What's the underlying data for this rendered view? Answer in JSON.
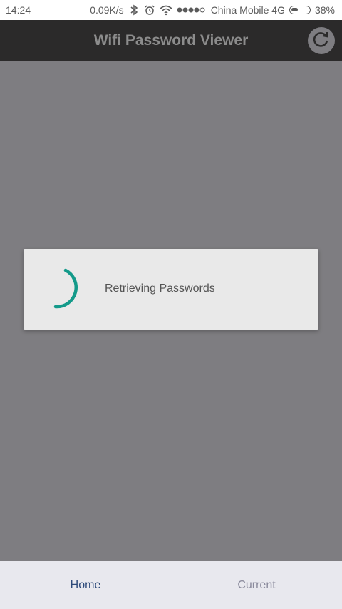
{
  "status_bar": {
    "time": "14:24",
    "speed": "0.09K/s",
    "carrier": "China Mobile 4G",
    "battery": "38%",
    "battery_level": 0.38,
    "icons": [
      "bluetooth-icon",
      "alarm-icon",
      "wifi-icon",
      "signal-dots-icon",
      "battery-icon"
    ]
  },
  "app_bar": {
    "title": "Wifi Password Viewer",
    "refresh_icon": "refresh-icon"
  },
  "dialog": {
    "message": "Retrieving Passwords",
    "spinner_color": "#149a8a"
  },
  "bottom_nav": {
    "items": [
      {
        "label": "Home",
        "active": true,
        "color": "#2d4a7a"
      },
      {
        "label": "Current",
        "active": false,
        "color": "#8a8a9c"
      }
    ]
  },
  "colors": {
    "app_bar": "#2b2a2a",
    "overlay": "#7e7d81",
    "dialog": "#e9e9e9",
    "accent": "#149a8a"
  }
}
